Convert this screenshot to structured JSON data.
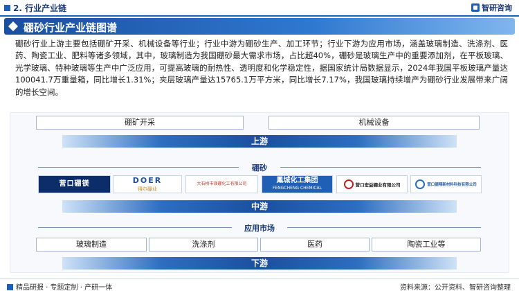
{
  "header": {
    "section": "2. 行业产业链",
    "brand": "智研咨询"
  },
  "title": "硼砂行业产业链图谱",
  "paragraph": "硼砂行业上游主要包括硼矿开采、机械设备等行业；行业中游为硼砂生产、加工环节；行业下游为应用市场，涵盖玻璃制造、洗涤剂、医药、陶瓷工业、肥料等诸多领域，其中，玻璃制造为我国硼砂最大需求市场，占比超40%，硼砂是玻璃生产中的重要添加剂，在平板玻璃、光学玻璃、特种玻璃等生产中广泛应用，可提高玻璃的耐热性、透明度和化学稳定性，据国家统计局数据显示，2024年我国平板玻璃产量达100041.7万重量箱，同比增长1.31%；夹层玻璃产量达15765.1万平方米，同比增长7.17%，我国玻璃持续增产为硼砂行业发展带来广阔的增长空间。",
  "upstream": {
    "items": [
      "硼矿开采",
      "机械设备"
    ],
    "label": "上游"
  },
  "midstream": {
    "category": "硼砂",
    "logos": [
      {
        "text": "营口硼镁",
        "icon": "company-logo"
      },
      {
        "text": "DOER",
        "sub": "得尔硼业",
        "icon": "company-logo"
      },
      {
        "text": "大石桥市镁硼化工有限公司",
        "icon": "company-logo"
      },
      {
        "text": "鳳城化工集团",
        "sub": "FENGCHENG CHEMICAL",
        "icon": "company-logo"
      },
      {
        "text": "营口宏益硼业有限公司",
        "icon": "company-logo"
      },
      {
        "text": "营口德翔新材料科技有限公司",
        "icon": "company-logo"
      }
    ],
    "label": "中游"
  },
  "downstream": {
    "category": "应用市场",
    "items": [
      "玻璃制造",
      "洗涤剂",
      "医药",
      "陶瓷工业等"
    ],
    "label": "下游"
  },
  "footer": {
    "left": "精品研报 · 专题定制 · 产研一体",
    "right": "资料来源：公开资料、智研咨询整理"
  }
}
